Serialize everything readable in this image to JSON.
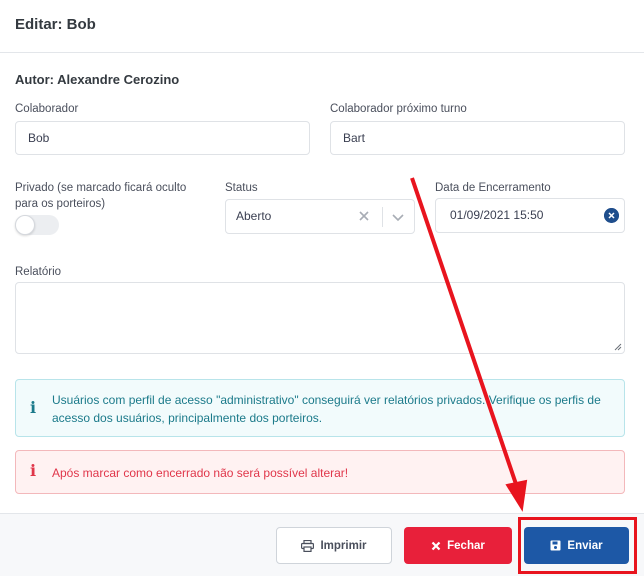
{
  "modal": {
    "title": "Editar: Bob"
  },
  "author": "Autor: Alexandre Cerozino",
  "fields": {
    "colaborador": {
      "label": "Colaborador",
      "value": "Bob"
    },
    "proximo_turno": {
      "label": "Colaborador próximo turno",
      "value": "Bart"
    },
    "privado": {
      "label": "Privado (se marcado ficará oculto para os porteiros)",
      "checked": false
    },
    "status": {
      "label": "Status",
      "value": "Aberto"
    },
    "encerramento": {
      "label": "Data de Encerramento",
      "value": "01/09/2021 15:50"
    },
    "relatorio": {
      "label": "Relatório",
      "value": ""
    }
  },
  "alerts": {
    "info": "Usuários com perfil de acesso \"administrativo\" conseguirá ver relatórios privados. Verifique os perfis de acesso dos usuários, principalmente dos porteiros.",
    "danger": "Após marcar como encerrado não será possível alterar!"
  },
  "buttons": {
    "print": "Imprimir",
    "close": "Fechar",
    "send": "Enviar"
  },
  "colors": {
    "primary": "#1d58a6",
    "danger": "#e8203a",
    "info": "#1b7a8a",
    "annotation": "#e8141e"
  },
  "icons": {
    "print": "printer-icon",
    "close": "x-icon",
    "send": "save-icon",
    "info": "info-icon",
    "danger": "exclamation-icon"
  }
}
